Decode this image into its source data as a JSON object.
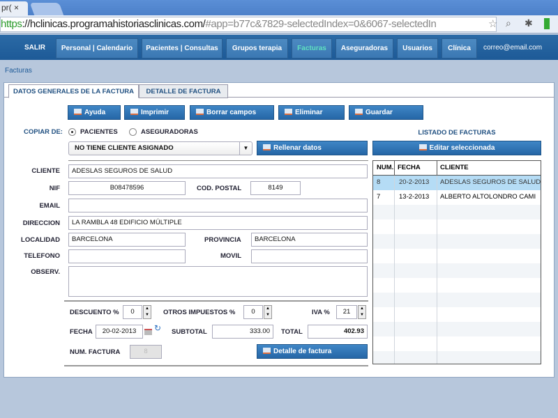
{
  "browser": {
    "tab_title": "pr(",
    "url_scheme": "https",
    "url_host": "://hclinicas.programahistoriasclinicas.com/",
    "url_rest": "#app=b77c&7829-selectedIndex=0&6067-selectedIn"
  },
  "nav": {
    "items": [
      "SALIR",
      "Personal | Calendario",
      "Pacientes | Consultas",
      "Grupos terapia",
      "Facturas",
      "Aseguradoras",
      "Usuarios",
      "Clínica"
    ],
    "email": "correo@email.com"
  },
  "breadcrumb": "Facturas",
  "tabs": [
    "DATOS GENERALES DE LA FACTURA",
    "DETALLE DE FACTURA"
  ],
  "toolbar": [
    "Ayuda",
    "Imprimir",
    "Borrar campos",
    "Eliminar",
    "Guardar"
  ],
  "copy": {
    "label": "COPIAR DE:",
    "options": [
      "PACIENTES",
      "ASEGURADORAS"
    ],
    "select_value": "NO TIENE CLIENTE ASIGNADO",
    "fill_button": "Rellenar datos"
  },
  "form": {
    "cliente_label": "CLIENTE",
    "cliente": "ADESLAS SEGUROS DE SALUD",
    "nif_label": "NIF",
    "nif": "B08478596",
    "cp_label": "COD. POSTAL",
    "cp": "8149",
    "email_label": "EMAIL",
    "email": "",
    "direccion_label": "DIRECCION",
    "direccion": "LA RAMBLA 48 EDIFICIO MÚLTIPLE",
    "localidad_label": "LOCALIDAD",
    "localidad": "BARCELONA",
    "provincia_label": "PROVINCIA",
    "provincia": "BARCELONA",
    "telefono_label": "TELEFONO",
    "telefono": "",
    "movil_label": "MOVIL",
    "movil": "",
    "observ_label": "OBSERV.",
    "observ": ""
  },
  "totals": {
    "descuento_label": "DESCUENTO %",
    "descuento": "0",
    "otros_label": "OTROS IMPUESTOS %",
    "otros": "0",
    "iva_label": "IVA %",
    "iva": "21",
    "fecha_label": "FECHA",
    "fecha": "20-02-2013",
    "subtotal_label": "SUBTOTAL",
    "subtotal": "333.00",
    "total_label": "TOTAL",
    "total": "402.93",
    "num_label": "NUM. FACTURA",
    "num": "8",
    "detalle_button": "Detalle de factura"
  },
  "list": {
    "title": "LISTADO DE FACTURAS",
    "edit_button": "Editar seleccionada",
    "columns": [
      "NUM.",
      "FECHA",
      "CLIENTE"
    ],
    "rows": [
      {
        "num": "8",
        "fecha": "20-2-2013",
        "cliente": "ADESLAS SEGUROS DE SALUD"
      },
      {
        "num": "7",
        "fecha": "13-2-2013",
        "cliente": "ALBERTO ALTOLONDRO CAMI"
      }
    ]
  }
}
